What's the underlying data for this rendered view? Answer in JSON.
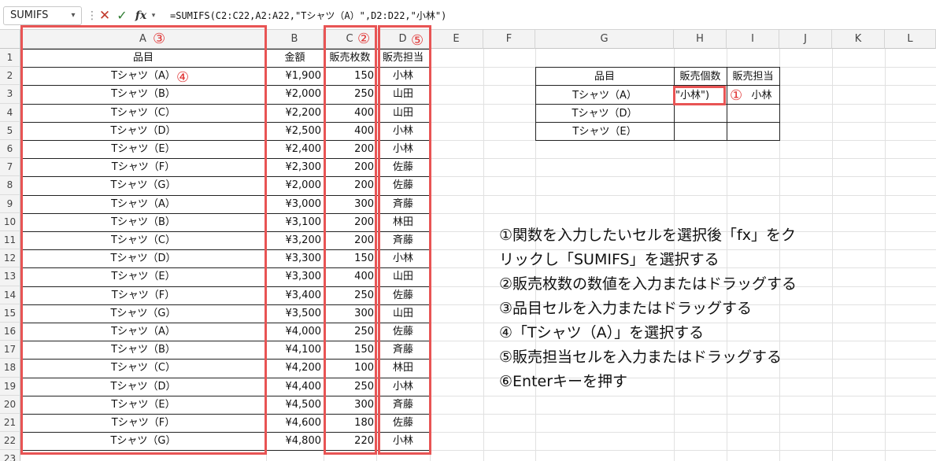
{
  "formula_bar": {
    "name_box": "SUMIFS",
    "formula": "=SUMIFS(C2:C22,A2:A22,\"Tシャツ（A）\",D2:D22,\"小林\")"
  },
  "columns": [
    "A",
    "B",
    "C",
    "D",
    "E",
    "F",
    "G",
    "H",
    "I",
    "J",
    "K",
    "L"
  ],
  "rows": [
    "1",
    "2",
    "3",
    "4",
    "5",
    "6",
    "7",
    "8",
    "9",
    "10",
    "11",
    "12",
    "13",
    "14",
    "15",
    "16",
    "17",
    "18",
    "19",
    "20",
    "21",
    "22",
    "23"
  ],
  "data_table": {
    "headers": [
      "品目",
      "金額",
      "販売枚数",
      "販売担当"
    ],
    "rows": [
      [
        "Tシャツ（A）",
        "¥1,900",
        "150",
        "小林"
      ],
      [
        "Tシャツ（B）",
        "¥2,000",
        "250",
        "山田"
      ],
      [
        "Tシャツ（C）",
        "¥2,200",
        "400",
        "山田"
      ],
      [
        "Tシャツ（D）",
        "¥2,500",
        "400",
        "小林"
      ],
      [
        "Tシャツ（E）",
        "¥2,400",
        "200",
        "小林"
      ],
      [
        "Tシャツ（F）",
        "¥2,300",
        "200",
        "佐藤"
      ],
      [
        "Tシャツ（G）",
        "¥2,000",
        "200",
        "佐藤"
      ],
      [
        "Tシャツ（A）",
        "¥3,000",
        "300",
        "斉藤"
      ],
      [
        "Tシャツ（B）",
        "¥3,100",
        "200",
        "林田"
      ],
      [
        "Tシャツ（C）",
        "¥3,200",
        "200",
        "斉藤"
      ],
      [
        "Tシャツ（D）",
        "¥3,300",
        "150",
        "小林"
      ],
      [
        "Tシャツ（E）",
        "¥3,300",
        "400",
        "山田"
      ],
      [
        "Tシャツ（F）",
        "¥3,400",
        "250",
        "佐藤"
      ],
      [
        "Tシャツ（G）",
        "¥3,500",
        "300",
        "山田"
      ],
      [
        "Tシャツ（A）",
        "¥4,000",
        "250",
        "佐藤"
      ],
      [
        "Tシャツ（B）",
        "¥4,100",
        "150",
        "斉藤"
      ],
      [
        "Tシャツ（C）",
        "¥4,200",
        "100",
        "林田"
      ],
      [
        "Tシャツ（D）",
        "¥4,400",
        "250",
        "小林"
      ],
      [
        "Tシャツ（E）",
        "¥4,500",
        "300",
        "斉藤"
      ],
      [
        "Tシャツ（F）",
        "¥4,600",
        "180",
        "佐藤"
      ],
      [
        "Tシャツ（G）",
        "¥4,800",
        "220",
        "小林"
      ]
    ]
  },
  "summary_table": {
    "headers": [
      "品目",
      "販売個数",
      "販売担当"
    ],
    "rows": [
      [
        "Tシャツ（A）",
        "\"小林\")",
        "小林"
      ],
      [
        "Tシャツ（D）",
        "",
        ""
      ],
      [
        "Tシャツ（E）",
        "",
        ""
      ]
    ]
  },
  "markers": {
    "m1": "①",
    "m2": "②",
    "m3": "③",
    "m4": "④",
    "m5": "⑤"
  },
  "instructions": [
    "①関数を入力したいセルを選択後「fx」をク",
    "リックし「SUMIFS」を選択する",
    "②販売枚数の数値を入力またはドラッグする",
    "③品目セルを入力またはドラッグする",
    "④「Tシャツ（A）」を選択する",
    "⑤販売担当セルを入力またはドラッグする",
    "⑥Enterキーを押す"
  ],
  "colors": {
    "annotation_red": "#e85454",
    "cancel_red": "#c0392b",
    "enter_green": "#2f7d32"
  }
}
